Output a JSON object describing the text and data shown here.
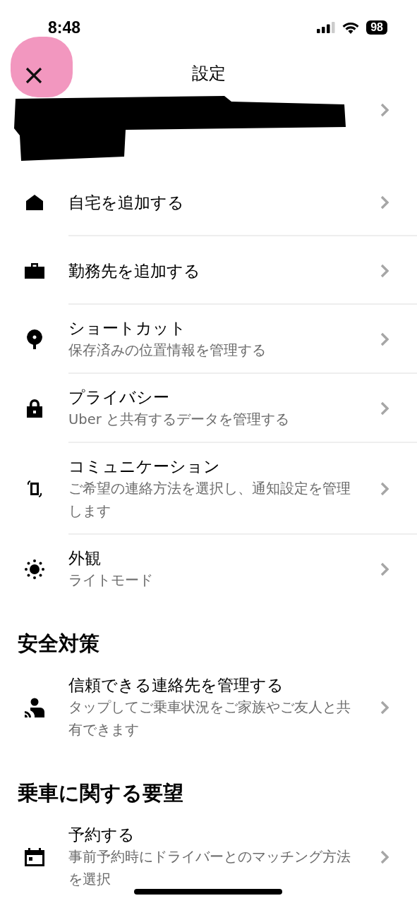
{
  "status_bar": {
    "time": "8:48",
    "battery": "98"
  },
  "header": {
    "title": "設定"
  },
  "sections": [
    {
      "items": [
        {
          "title": "自宅を追加する"
        },
        {
          "title": "勤務先を追加する"
        },
        {
          "title": "ショートカット",
          "subtitle": "保存済みの位置情報を管理する"
        },
        {
          "title": "プライバシー",
          "subtitle": "Uber と共有するデータを管理する"
        },
        {
          "title": "コミュニケーション",
          "subtitle": "ご希望の連絡方法を選択し、通知設定を管理します"
        },
        {
          "title": "外観",
          "subtitle": "ライトモード"
        }
      ]
    },
    {
      "heading": "安全対策",
      "items": [
        {
          "title": "信頼できる連絡先を管理する",
          "subtitle": "タップしてご乗車状況をご家族やご友人と共有できます"
        }
      ]
    },
    {
      "heading": "乗車に関する要望",
      "items": [
        {
          "title": "予約する",
          "subtitle": "事前予約時にドライバーとのマッチング方法を選択"
        }
      ]
    }
  ]
}
